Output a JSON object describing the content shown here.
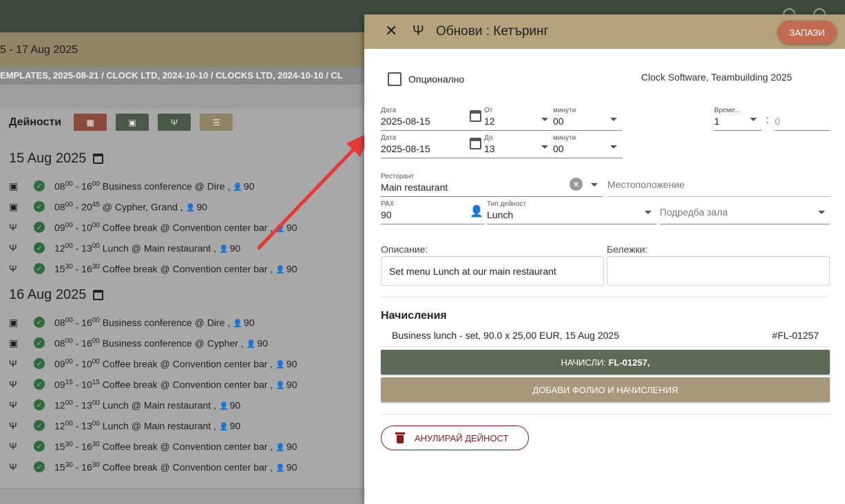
{
  "background": {
    "date_range": "5 - 17 Aug 2025",
    "breadcrumbs": "EMPLATES, 2025-08-21  /  CLOCK LTD, 2024-10-10  /  CLOCKS LTD, 2024-10-10  /  CL",
    "activities_title": "Дейности",
    "days": [
      {
        "title": "15 Aug 2025",
        "events": [
          {
            "icon": "contact-icon",
            "start_h": "08",
            "start_m": "00",
            "end_h": "16",
            "end_m": "00",
            "text": "Business conference @ Dire ,",
            "pax": "90"
          },
          {
            "icon": "contact-icon",
            "start_h": "08",
            "start_m": "00",
            "end_h": "20",
            "end_m": "45",
            "text": "@ Cypher, Grand ,",
            "pax": "90"
          },
          {
            "icon": "fork-knife-icon",
            "start_h": "09",
            "start_m": "00",
            "end_h": "10",
            "end_m": "00",
            "text": "Coffee break @ Convention center bar ,",
            "pax": "90"
          },
          {
            "icon": "fork-knife-icon",
            "start_h": "12",
            "start_m": "00",
            "end_h": "13",
            "end_m": "00",
            "text": "Lunch @ Main restaurant ,",
            "pax": "90"
          },
          {
            "icon": "fork-knife-icon",
            "start_h": "15",
            "start_m": "30",
            "end_h": "16",
            "end_m": "30",
            "text": "Coffee break @ Convention center bar ,",
            "pax": "90"
          }
        ]
      },
      {
        "title": "16 Aug 2025",
        "events": [
          {
            "icon": "contact-icon",
            "start_h": "08",
            "start_m": "00",
            "end_h": "16",
            "end_m": "00",
            "text": "Business conference @ Dire ,",
            "pax": "90"
          },
          {
            "icon": "contact-icon",
            "start_h": "08",
            "start_m": "00",
            "end_h": "16",
            "end_m": "00",
            "text": "Business conference @ Cypher ,",
            "pax": "90"
          },
          {
            "icon": "fork-knife-icon",
            "start_h": "09",
            "start_m": "00",
            "end_h": "10",
            "end_m": "00",
            "text": "Coffee break @ Convention center bar ,",
            "pax": "90"
          },
          {
            "icon": "fork-knife-icon",
            "start_h": "09",
            "start_m": "15",
            "end_h": "10",
            "end_m": "15",
            "text": "Coffee break @ Convention center bar ,",
            "pax": "90"
          },
          {
            "icon": "fork-knife-icon",
            "start_h": "12",
            "start_m": "00",
            "end_h": "13",
            "end_m": "00",
            "text": "Lunch @ Main restaurant ,",
            "pax": "90"
          },
          {
            "icon": "fork-knife-icon",
            "start_h": "12",
            "start_m": "00",
            "end_h": "13",
            "end_m": "00",
            "text": "Lunch @ Main restaurant ,",
            "pax": "90"
          },
          {
            "icon": "fork-knife-icon",
            "start_h": "15",
            "start_m": "30",
            "end_h": "16",
            "end_m": "30",
            "text": "Coffee break @ Convention center bar ,",
            "pax": "90"
          },
          {
            "icon": "fork-knife-icon",
            "start_h": "15",
            "start_m": "30",
            "end_h": "16",
            "end_m": "30",
            "text": "Coffee break @ Convention center bar ,",
            "pax": "90"
          }
        ]
      }
    ]
  },
  "dialog": {
    "title": "Обнови : Кетъринг",
    "save_label": "ЗАПАЗИ",
    "optional_label": "Опционално",
    "client": "Clock Software, Teambuilding 2025",
    "start": {
      "date_label": "Дата",
      "date": "2025-08-15",
      "hour_label": "От",
      "hour": "12",
      "min_label": "минути",
      "min": "00"
    },
    "end": {
      "date_label": "Дата",
      "date": "2025-08-15",
      "hour_label": "До",
      "hour": "13",
      "min_label": "минути",
      "min": "00"
    },
    "duration": {
      "label": "Време...",
      "hours": "1",
      "sep": ":",
      "minutes": "0"
    },
    "restaurant": {
      "label": "Ресторант",
      "value": "Main restaurant"
    },
    "location_placeholder": "Местоположение",
    "pax": {
      "label": "PAX",
      "value": "90"
    },
    "activity_type": {
      "label": "Тип дейност",
      "value": "Lunch"
    },
    "hall_setup_placeholder": "Подредба зала",
    "description_label": "Описание:",
    "description": "Set menu Lunch at our main restaurant",
    "notes_label": "Бележки:",
    "notes": "",
    "charges_title": "Начисления",
    "charge_line": "Business lunch - set, 90.0 x 25,00 EUR, 15 Aug 2025",
    "charge_ref": "#FL-01257",
    "charged_prefix": "НАЧИСЛИ: ",
    "charged_ref": "FL-01257,",
    "add_folio_label": "ДОБАВИ ФОЛИО И НАЧИСЛЕНИЯ",
    "cancel_label": "АНУЛИРАЙ ДЕЙНОСТ"
  },
  "colors": {
    "header_tan": "#b3a27c",
    "save_orange": "#c46c52",
    "charge_green": "#5f6a56",
    "folio_tan": "#a9977a",
    "cancel_red": "#8b1a1a",
    "arrow_red": "#e53935"
  }
}
